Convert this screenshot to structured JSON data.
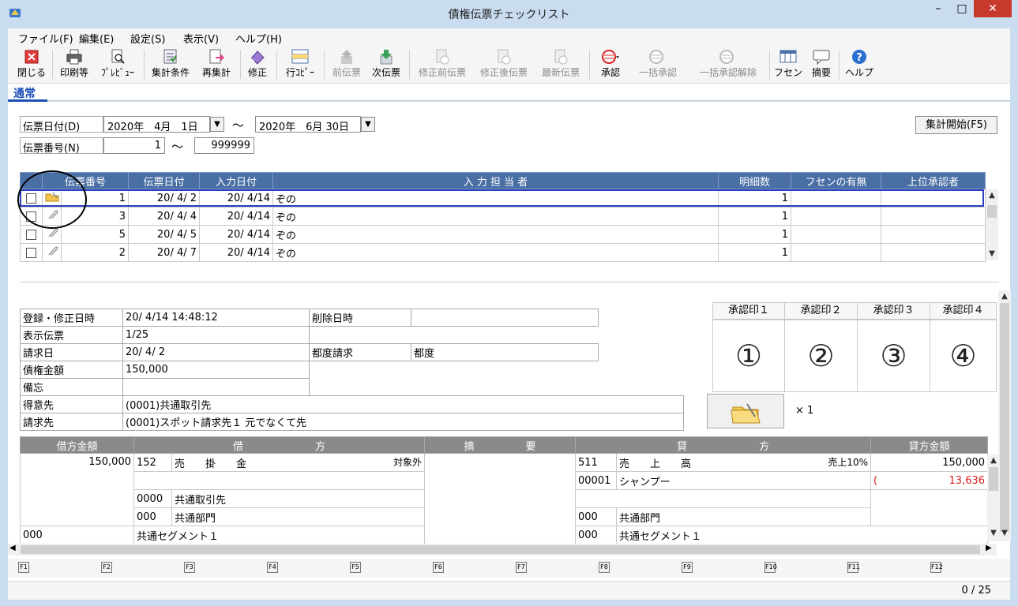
{
  "window": {
    "title": "債権伝票チェックリスト",
    "minimize": "–",
    "maximize": "□",
    "close": "✕"
  },
  "menu": [
    "ファイル(F)",
    "編集(E)",
    "設定(S)",
    "表示(V)",
    "ヘルプ(H)"
  ],
  "toolbar": [
    {
      "label": "閉じる",
      "icon": "close-icon",
      "enabled": true
    },
    {
      "label": "印刷等",
      "icon": "printer-icon",
      "enabled": true
    },
    {
      "label": "ﾌﾟﾚﾋﾞｭｰ",
      "icon": "preview-icon",
      "enabled": true
    },
    {
      "label": "集計条件",
      "icon": "condition-icon",
      "enabled": true
    },
    {
      "label": "再集計",
      "icon": "recalc-icon",
      "enabled": true
    },
    {
      "label": "修正",
      "icon": "eraser-icon",
      "enabled": true
    },
    {
      "label": "行ｺﾋﾟｰ",
      "icon": "row-copy-icon",
      "enabled": true
    },
    {
      "label": "前伝票",
      "icon": "prev-slip-icon",
      "enabled": false
    },
    {
      "label": "次伝票",
      "icon": "next-slip-icon",
      "enabled": true
    },
    {
      "label": "修正前伝票",
      "icon": "before-edit-icon",
      "enabled": false
    },
    {
      "label": "修正後伝票",
      "icon": "after-edit-icon",
      "enabled": false
    },
    {
      "label": "最新伝票",
      "icon": "latest-slip-icon",
      "enabled": false
    },
    {
      "label": "承認",
      "icon": "approve-stamp-icon",
      "enabled": true
    },
    {
      "label": "一括承認",
      "icon": "bulk-approve-icon",
      "enabled": false
    },
    {
      "label": "一括承認解除",
      "icon": "bulk-unapprove-icon",
      "enabled": false
    },
    {
      "label": "フセン",
      "icon": "sticky-note-icon",
      "enabled": true
    },
    {
      "label": "摘要",
      "icon": "memo-bubble-icon",
      "enabled": true
    },
    {
      "label": "ヘルプ",
      "icon": "help-icon",
      "enabled": true
    }
  ],
  "tab": "通常",
  "filters": {
    "date_label": "伝票日付(D)",
    "date_from": "2020年　4月　1日",
    "date_to": "2020年　6月 30日",
    "range_sep": "～",
    "number_label": "伝票番号(N)",
    "number_from": "1",
    "number_to": "999999",
    "start_button": "集計開始(F5)"
  },
  "slip_table": {
    "headers": [
      "伝票番号",
      "伝票日付",
      "入力日付",
      "入 力 担 当 者",
      "明細数",
      "フセンの有無",
      "上位承認者"
    ],
    "rows": [
      {
        "number": "1",
        "date": "20/ 4/ 2",
        "input_date": "20/ 4/14",
        "person": "ぞの",
        "details": "1",
        "fusen": "",
        "approver": ""
      },
      {
        "number": "3",
        "date": "20/ 4/ 4",
        "input_date": "20/ 4/14",
        "person": "ぞの",
        "details": "1",
        "fusen": "",
        "approver": ""
      },
      {
        "number": "5",
        "date": "20/ 4/ 5",
        "input_date": "20/ 4/14",
        "person": "ぞの",
        "details": "1",
        "fusen": "",
        "approver": ""
      },
      {
        "number": "2",
        "date": "20/ 4/ 7",
        "input_date": "20/ 4/14",
        "person": "ぞの",
        "details": "1",
        "fusen": "",
        "approver": ""
      }
    ]
  },
  "detail": {
    "reg_label": "登録・修正日時",
    "reg_value": "20/ 4/14 14:48:12",
    "del_label": "削除日時",
    "del_value": "",
    "disp_label": "表示伝票",
    "disp_value": " 1/25",
    "bill_label": "請求日",
    "bill_value": "20/ 4/ 2",
    "tsudo_label": "都度請求",
    "tsudo_value": "都度",
    "amount_label": "債権金額",
    "amount_value": "150,000",
    "memo_label": "備忘",
    "memo_value": "",
    "customer_label": "得意先",
    "customer_value": "(0001)共通取引先",
    "billto_label": "請求先",
    "billto_value": "(0001)スポット請求先１ 元でなくて先"
  },
  "stamps": {
    "headers": [
      "承認印１",
      "承認印２",
      "承認印３",
      "承認印４"
    ],
    "marks": [
      "①",
      "②",
      "③",
      "④"
    ],
    "fusen_count": "× 1"
  },
  "journal": {
    "headers": [
      "借方金額",
      "借　　　　　　　方",
      "摘　　　　　要",
      "貸　　　　　　　方",
      "貸方金額"
    ],
    "debit_amount": "150,000",
    "debit_code": "152",
    "debit_name": "売　　掛　　金",
    "debit_tax": "対象外",
    "debit_partner_code": "0000",
    "debit_partner_name": "共通取引先",
    "debit_dept_code": "000",
    "debit_dept_name": "共通部門",
    "seg_code": "000",
    "seg_name": "共通セグメント１",
    "credit_code": "511",
    "credit_name": "売　　上　　高",
    "credit_tax": "売上10%",
    "credit_amount": "150,000",
    "credit_sub_code": "00001",
    "credit_sub_name": "シャンプー",
    "credit_tax_amount": "13,636",
    "credit_tax_paren": "(",
    "credit_dept_code": "000",
    "credit_dept_name": "共通部門",
    "credit_seg_code": "000",
    "credit_seg_name": "共通セグメント１"
  },
  "fkeys": [
    "F1",
    "F2",
    "F3",
    "F4",
    "F5",
    "F6",
    "F7",
    "F8",
    "F9",
    "F10",
    "F11",
    "F12"
  ],
  "status": {
    "page": "0 / 25"
  },
  "colors": {
    "header_blue": "#4a6fa5",
    "selection": "#2a3fbf",
    "accent_red": "#d82020",
    "close_red": "#c7392b"
  }
}
